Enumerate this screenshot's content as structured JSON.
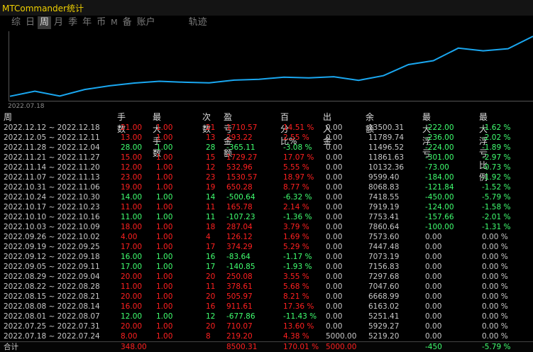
{
  "window": {
    "title": "MTCommander统计"
  },
  "tabs": [
    {
      "label": "综"
    },
    {
      "label": "日"
    },
    {
      "label": "周",
      "active": true
    },
    {
      "label": "月"
    },
    {
      "label": "季"
    },
    {
      "label": "年"
    },
    {
      "label": "币"
    },
    {
      "label": "M"
    },
    {
      "label": "备"
    },
    {
      "label": "账户"
    },
    {
      "label": "轨迹"
    }
  ],
  "chart": {
    "start_label": "2022.07.18",
    "line_color": "#1aa7f0",
    "balances": [
      5219.2,
      5929.27,
      5251.41,
      6163.02,
      6668.99,
      7047.6,
      7297.68,
      7156.83,
      7073.19,
      7447.48,
      7573.6,
      7860.64,
      7753.41,
      7919.19,
      7418.55,
      8068.83,
      9599.4,
      10132.36,
      11861.63,
      11496.52,
      11789.74,
      13500.31
    ]
  },
  "colors": {
    "positive": "#ff2020",
    "negative": "#40ff70",
    "neutral": "#c8c8c8"
  },
  "headers": [
    "周",
    "手数",
    "最大手数",
    "次数",
    "盈亏金额",
    "百分比%",
    "出入金",
    "余额",
    "最大浮亏",
    "最大浮亏比例"
  ],
  "rows": [
    {
      "week": "2022.12.12 ~ 2022.12.18",
      "lots": "21.00",
      "max_lots": "1.00",
      "count": "21",
      "pnl": "1710.57",
      "pct": "14.51 %",
      "io": "0.00",
      "balance": "13500.31",
      "max_dd": "-222.00",
      "dd_pct": "-1.62 %",
      "dir": "pos"
    },
    {
      "week": "2022.12.05 ~ 2022.12.11",
      "lots": "13.00",
      "max_lots": "1.00",
      "count": "13",
      "pnl": "293.22",
      "pct": "2.55 %",
      "io": "0.00",
      "balance": "11789.74",
      "max_dd": "-236.00",
      "dd_pct": "-2.02 %",
      "dir": "pos"
    },
    {
      "week": "2022.11.28 ~ 2022.12.04",
      "lots": "28.00",
      "max_lots": "1.00",
      "count": "28",
      "pnl": "-365.11",
      "pct": "-3.08 %",
      "io": "0.00",
      "balance": "11496.52",
      "max_dd": "-224.00",
      "dd_pct": "-1.89 %",
      "dir": "neg"
    },
    {
      "week": "2022.11.21 ~ 2022.11.27",
      "lots": "15.00",
      "max_lots": "1.00",
      "count": "15",
      "pnl": "1729.27",
      "pct": "17.07 %",
      "io": "0.00",
      "balance": "11861.63",
      "max_dd": "-301.00",
      "dd_pct": "-2.97 %",
      "dir": "pos"
    },
    {
      "week": "2022.11.14 ~ 2022.11.20",
      "lots": "12.00",
      "max_lots": "1.00",
      "count": "12",
      "pnl": "532.96",
      "pct": "5.55 %",
      "io": "0.00",
      "balance": "10132.36",
      "max_dd": "-73.00",
      "dd_pct": "-0.73 %",
      "dir": "pos"
    },
    {
      "week": "2022.11.07 ~ 2022.11.13",
      "lots": "23.00",
      "max_lots": "1.00",
      "count": "23",
      "pnl": "1530.57",
      "pct": "18.97 %",
      "io": "0.00",
      "balance": "9599.40",
      "max_dd": "-184.00",
      "dd_pct": "-1.92 %",
      "dir": "pos"
    },
    {
      "week": "2022.10.31 ~ 2022.11.06",
      "lots": "19.00",
      "max_lots": "1.00",
      "count": "19",
      "pnl": "650.28",
      "pct": "8.77 %",
      "io": "0.00",
      "balance": "8068.83",
      "max_dd": "-121.84",
      "dd_pct": "-1.52 %",
      "dir": "pos"
    },
    {
      "week": "2022.10.24 ~ 2022.10.30",
      "lots": "14.00",
      "max_lots": "1.00",
      "count": "14",
      "pnl": "-500.64",
      "pct": "-6.32 %",
      "io": "0.00",
      "balance": "7418.55",
      "max_dd": "-450.00",
      "dd_pct": "-5.79 %",
      "dir": "neg"
    },
    {
      "week": "2022.10.17 ~ 2022.10.23",
      "lots": "11.00",
      "max_lots": "1.00",
      "count": "11",
      "pnl": "165.78",
      "pct": "2.14 %",
      "io": "0.00",
      "balance": "7919.19",
      "max_dd": "-124.00",
      "dd_pct": "-1.58 %",
      "dir": "pos"
    },
    {
      "week": "2022.10.10 ~ 2022.10.16",
      "lots": "11.00",
      "max_lots": "1.00",
      "count": "11",
      "pnl": "-107.23",
      "pct": "-1.36 %",
      "io": "0.00",
      "balance": "7753.41",
      "max_dd": "-157.66",
      "dd_pct": "-2.01 %",
      "dir": "neg"
    },
    {
      "week": "2022.10.03 ~ 2022.10.09",
      "lots": "18.00",
      "max_lots": "1.00",
      "count": "18",
      "pnl": "287.04",
      "pct": "3.79 %",
      "io": "0.00",
      "balance": "7860.64",
      "max_dd": "-100.00",
      "dd_pct": "-1.31 %",
      "dir": "pos"
    },
    {
      "week": "2022.09.26 ~ 2022.10.02",
      "lots": "4.00",
      "max_lots": "1.00",
      "count": "4",
      "pnl": "126.12",
      "pct": "1.69 %",
      "io": "0.00",
      "balance": "7573.60",
      "max_dd": "0.00",
      "dd_pct": "0.00 %",
      "dir": "pos"
    },
    {
      "week": "2022.09.19 ~ 2022.09.25",
      "lots": "17.00",
      "max_lots": "1.00",
      "count": "17",
      "pnl": "374.29",
      "pct": "5.29 %",
      "io": "0.00",
      "balance": "7447.48",
      "max_dd": "0.00",
      "dd_pct": "0.00 %",
      "dir": "pos"
    },
    {
      "week": "2022.09.12 ~ 2022.09.18",
      "lots": "16.00",
      "max_lots": "1.00",
      "count": "16",
      "pnl": "-83.64",
      "pct": "-1.17 %",
      "io": "0.00",
      "balance": "7073.19",
      "max_dd": "0.00",
      "dd_pct": "0.00 %",
      "dir": "neg"
    },
    {
      "week": "2022.09.05 ~ 2022.09.11",
      "lots": "17.00",
      "max_lots": "1.00",
      "count": "17",
      "pnl": "-140.85",
      "pct": "-1.93 %",
      "io": "0.00",
      "balance": "7156.83",
      "max_dd": "0.00",
      "dd_pct": "0.00 %",
      "dir": "neg"
    },
    {
      "week": "2022.08.29 ~ 2022.09.04",
      "lots": "20.00",
      "max_lots": "1.00",
      "count": "20",
      "pnl": "250.08",
      "pct": "3.55 %",
      "io": "0.00",
      "balance": "7297.68",
      "max_dd": "0.00",
      "dd_pct": "0.00 %",
      "dir": "pos"
    },
    {
      "week": "2022.08.22 ~ 2022.08.28",
      "lots": "11.00",
      "max_lots": "1.00",
      "count": "11",
      "pnl": "378.61",
      "pct": "5.68 %",
      "io": "0.00",
      "balance": "7047.60",
      "max_dd": "0.00",
      "dd_pct": "0.00 %",
      "dir": "pos"
    },
    {
      "week": "2022.08.15 ~ 2022.08.21",
      "lots": "20.00",
      "max_lots": "1.00",
      "count": "20",
      "pnl": "505.97",
      "pct": "8.21 %",
      "io": "0.00",
      "balance": "6668.99",
      "max_dd": "0.00",
      "dd_pct": "0.00 %",
      "dir": "pos"
    },
    {
      "week": "2022.08.08 ~ 2022.08.14",
      "lots": "16.00",
      "max_lots": "1.00",
      "count": "16",
      "pnl": "911.61",
      "pct": "17.36 %",
      "io": "0.00",
      "balance": "6163.02",
      "max_dd": "0.00",
      "dd_pct": "0.00 %",
      "dir": "pos"
    },
    {
      "week": "2022.08.01 ~ 2022.08.07",
      "lots": "12.00",
      "max_lots": "1.00",
      "count": "12",
      "pnl": "-677.86",
      "pct": "-11.43 %",
      "io": "0.00",
      "balance": "5251.41",
      "max_dd": "0.00",
      "dd_pct": "0.00 %",
      "dir": "neg"
    },
    {
      "week": "2022.07.25 ~ 2022.07.31",
      "lots": "20.00",
      "max_lots": "1.00",
      "count": "20",
      "pnl": "710.07",
      "pct": "13.60 %",
      "io": "0.00",
      "balance": "5929.27",
      "max_dd": "0.00",
      "dd_pct": "0.00 %",
      "dir": "pos"
    },
    {
      "week": "2022.07.18 ~ 2022.07.24",
      "lots": "8.00",
      "max_lots": "1.00",
      "count": "8",
      "pnl": "219.20",
      "pct": "4.38 %",
      "io": "5000.00",
      "balance": "5219.20",
      "max_dd": "0.00",
      "dd_pct": "0.00 %",
      "dir": "pos"
    }
  ],
  "total": {
    "label": "合计",
    "lots": "348.00",
    "pnl": "8500.31",
    "pct": "170.01 %",
    "io": "5000.00",
    "max_dd": "-450",
    "dd_pct": "-5.79 %"
  }
}
